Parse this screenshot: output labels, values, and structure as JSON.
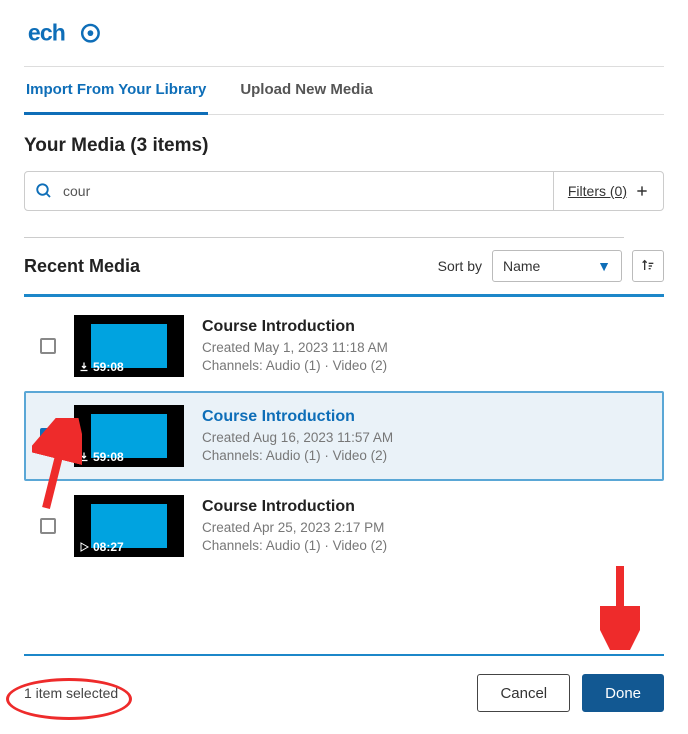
{
  "logo": "echo",
  "tabs": [
    {
      "label": "Import From Your Library",
      "active": true
    },
    {
      "label": "Upload New Media",
      "active": false
    }
  ],
  "your_media_title": "Your Media (3 items)",
  "search": {
    "value": "cour",
    "filters_label": "Filters (0)"
  },
  "recent": {
    "title": "Recent Media",
    "sortby_label": "Sort by",
    "sort_value": "Name"
  },
  "items": [
    {
      "title": "Course Introduction",
      "created": "Created May 1, 2023 11:18 AM",
      "channels": "Channels: Audio (1) · Video (2)",
      "duration": "59:08",
      "selected": false,
      "thumb_icon": "download"
    },
    {
      "title": "Course Introduction",
      "created": "Created Aug 16, 2023 11:57 AM",
      "channels": "Channels: Audio (1) · Video (2)",
      "duration": "59:08",
      "selected": true,
      "thumb_icon": "download"
    },
    {
      "title": "Course Introduction",
      "created": "Created Apr 25, 2023 2:17 PM",
      "channels": "Channels: Audio (1) · Video (2)",
      "duration": "08:27",
      "selected": false,
      "thumb_icon": "play"
    }
  ],
  "footer": {
    "selected_text": "1 item selected",
    "cancel": "Cancel",
    "done": "Done"
  }
}
